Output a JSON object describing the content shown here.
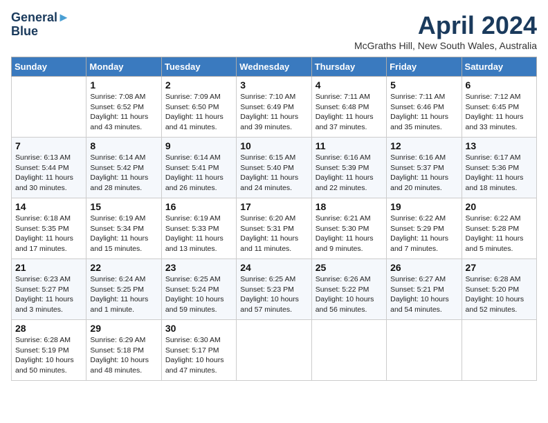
{
  "header": {
    "logo_line1": "General",
    "logo_line2": "Blue",
    "month_title": "April 2024",
    "location": "McGraths Hill, New South Wales, Australia"
  },
  "weekdays": [
    "Sunday",
    "Monday",
    "Tuesday",
    "Wednesday",
    "Thursday",
    "Friday",
    "Saturday"
  ],
  "weeks": [
    [
      {
        "day": "",
        "sunrise": "",
        "sunset": "",
        "daylight": ""
      },
      {
        "day": "1",
        "sunrise": "Sunrise: 7:08 AM",
        "sunset": "Sunset: 6:52 PM",
        "daylight": "Daylight: 11 hours and 43 minutes."
      },
      {
        "day": "2",
        "sunrise": "Sunrise: 7:09 AM",
        "sunset": "Sunset: 6:50 PM",
        "daylight": "Daylight: 11 hours and 41 minutes."
      },
      {
        "day": "3",
        "sunrise": "Sunrise: 7:10 AM",
        "sunset": "Sunset: 6:49 PM",
        "daylight": "Daylight: 11 hours and 39 minutes."
      },
      {
        "day": "4",
        "sunrise": "Sunrise: 7:11 AM",
        "sunset": "Sunset: 6:48 PM",
        "daylight": "Daylight: 11 hours and 37 minutes."
      },
      {
        "day": "5",
        "sunrise": "Sunrise: 7:11 AM",
        "sunset": "Sunset: 6:46 PM",
        "daylight": "Daylight: 11 hours and 35 minutes."
      },
      {
        "day": "6",
        "sunrise": "Sunrise: 7:12 AM",
        "sunset": "Sunset: 6:45 PM",
        "daylight": "Daylight: 11 hours and 33 minutes."
      }
    ],
    [
      {
        "day": "7",
        "sunrise": "Sunrise: 6:13 AM",
        "sunset": "Sunset: 5:44 PM",
        "daylight": "Daylight: 11 hours and 30 minutes."
      },
      {
        "day": "8",
        "sunrise": "Sunrise: 6:14 AM",
        "sunset": "Sunset: 5:42 PM",
        "daylight": "Daylight: 11 hours and 28 minutes."
      },
      {
        "day": "9",
        "sunrise": "Sunrise: 6:14 AM",
        "sunset": "Sunset: 5:41 PM",
        "daylight": "Daylight: 11 hours and 26 minutes."
      },
      {
        "day": "10",
        "sunrise": "Sunrise: 6:15 AM",
        "sunset": "Sunset: 5:40 PM",
        "daylight": "Daylight: 11 hours and 24 minutes."
      },
      {
        "day": "11",
        "sunrise": "Sunrise: 6:16 AM",
        "sunset": "Sunset: 5:39 PM",
        "daylight": "Daylight: 11 hours and 22 minutes."
      },
      {
        "day": "12",
        "sunrise": "Sunrise: 6:16 AM",
        "sunset": "Sunset: 5:37 PM",
        "daylight": "Daylight: 11 hours and 20 minutes."
      },
      {
        "day": "13",
        "sunrise": "Sunrise: 6:17 AM",
        "sunset": "Sunset: 5:36 PM",
        "daylight": "Daylight: 11 hours and 18 minutes."
      }
    ],
    [
      {
        "day": "14",
        "sunrise": "Sunrise: 6:18 AM",
        "sunset": "Sunset: 5:35 PM",
        "daylight": "Daylight: 11 hours and 17 minutes."
      },
      {
        "day": "15",
        "sunrise": "Sunrise: 6:19 AM",
        "sunset": "Sunset: 5:34 PM",
        "daylight": "Daylight: 11 hours and 15 minutes."
      },
      {
        "day": "16",
        "sunrise": "Sunrise: 6:19 AM",
        "sunset": "Sunset: 5:33 PM",
        "daylight": "Daylight: 11 hours and 13 minutes."
      },
      {
        "day": "17",
        "sunrise": "Sunrise: 6:20 AM",
        "sunset": "Sunset: 5:31 PM",
        "daylight": "Daylight: 11 hours and 11 minutes."
      },
      {
        "day": "18",
        "sunrise": "Sunrise: 6:21 AM",
        "sunset": "Sunset: 5:30 PM",
        "daylight": "Daylight: 11 hours and 9 minutes."
      },
      {
        "day": "19",
        "sunrise": "Sunrise: 6:22 AM",
        "sunset": "Sunset: 5:29 PM",
        "daylight": "Daylight: 11 hours and 7 minutes."
      },
      {
        "day": "20",
        "sunrise": "Sunrise: 6:22 AM",
        "sunset": "Sunset: 5:28 PM",
        "daylight": "Daylight: 11 hours and 5 minutes."
      }
    ],
    [
      {
        "day": "21",
        "sunrise": "Sunrise: 6:23 AM",
        "sunset": "Sunset: 5:27 PM",
        "daylight": "Daylight: 11 hours and 3 minutes."
      },
      {
        "day": "22",
        "sunrise": "Sunrise: 6:24 AM",
        "sunset": "Sunset: 5:25 PM",
        "daylight": "Daylight: 11 hours and 1 minute."
      },
      {
        "day": "23",
        "sunrise": "Sunrise: 6:25 AM",
        "sunset": "Sunset: 5:24 PM",
        "daylight": "Daylight: 10 hours and 59 minutes."
      },
      {
        "day": "24",
        "sunrise": "Sunrise: 6:25 AM",
        "sunset": "Sunset: 5:23 PM",
        "daylight": "Daylight: 10 hours and 57 minutes."
      },
      {
        "day": "25",
        "sunrise": "Sunrise: 6:26 AM",
        "sunset": "Sunset: 5:22 PM",
        "daylight": "Daylight: 10 hours and 56 minutes."
      },
      {
        "day": "26",
        "sunrise": "Sunrise: 6:27 AM",
        "sunset": "Sunset: 5:21 PM",
        "daylight": "Daylight: 10 hours and 54 minutes."
      },
      {
        "day": "27",
        "sunrise": "Sunrise: 6:28 AM",
        "sunset": "Sunset: 5:20 PM",
        "daylight": "Daylight: 10 hours and 52 minutes."
      }
    ],
    [
      {
        "day": "28",
        "sunrise": "Sunrise: 6:28 AM",
        "sunset": "Sunset: 5:19 PM",
        "daylight": "Daylight: 10 hours and 50 minutes."
      },
      {
        "day": "29",
        "sunrise": "Sunrise: 6:29 AM",
        "sunset": "Sunset: 5:18 PM",
        "daylight": "Daylight: 10 hours and 48 minutes."
      },
      {
        "day": "30",
        "sunrise": "Sunrise: 6:30 AM",
        "sunset": "Sunset: 5:17 PM",
        "daylight": "Daylight: 10 hours and 47 minutes."
      },
      {
        "day": "",
        "sunrise": "",
        "sunset": "",
        "daylight": ""
      },
      {
        "day": "",
        "sunrise": "",
        "sunset": "",
        "daylight": ""
      },
      {
        "day": "",
        "sunrise": "",
        "sunset": "",
        "daylight": ""
      },
      {
        "day": "",
        "sunrise": "",
        "sunset": "",
        "daylight": ""
      }
    ]
  ]
}
